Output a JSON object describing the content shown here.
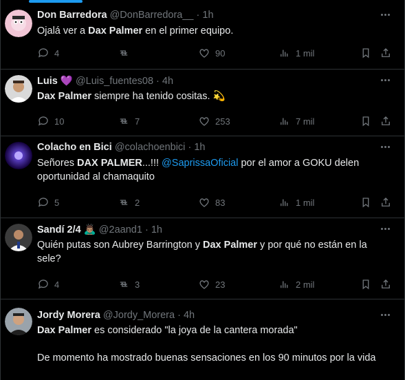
{
  "tweets": [
    {
      "name": "Don Barredora",
      "handle": "@DonBarredora__",
      "time": "1h",
      "body_segments": [
        {
          "text": "Ojalá ver a ",
          "style": "normal"
        },
        {
          "text": "Dax Palmer",
          "style": "bold"
        },
        {
          "text": " en el primer equipo.",
          "style": "normal"
        }
      ],
      "replies": "4",
      "retweets": "",
      "likes": "90",
      "views": "1 mil"
    },
    {
      "name": "Luis",
      "name_badge": "💜",
      "handle": "@Luis_fuentes08",
      "time": "4h",
      "body_segments": [
        {
          "text": "Dax Palmer",
          "style": "bold"
        },
        {
          "text": " siempre ha tenido cositas. 💫",
          "style": "normal"
        }
      ],
      "replies": "10",
      "retweets": "7",
      "likes": "253",
      "views": "7 mil"
    },
    {
      "name": "Colacho en Bici",
      "handle": "@colachoenbici",
      "time": "1h",
      "body_segments": [
        {
          "text": "Señores ",
          "style": "normal"
        },
        {
          "text": "DAX PALMER",
          "style": "bold"
        },
        {
          "text": "...!!! ",
          "style": "normal"
        },
        {
          "text": "@SaprissaOficial",
          "style": "mention"
        },
        {
          "text": " por el amor a GOKU delen oportunidad al chamaquito",
          "style": "normal"
        }
      ],
      "replies": "5",
      "retweets": "2",
      "likes": "83",
      "views": "1 mil"
    },
    {
      "name": "Sandí 2/4",
      "name_badge": "🙇🏽‍♂️",
      "handle": "@2aand1",
      "time": "1h",
      "body_segments": [
        {
          "text": "Quién putas son Aubrey Barrington y ",
          "style": "normal"
        },
        {
          "text": "Dax Palmer",
          "style": "bold"
        },
        {
          "text": " y por qué no están en la sele?",
          "style": "normal"
        }
      ],
      "replies": "4",
      "retweets": "3",
      "likes": "23",
      "views": "2 mil"
    },
    {
      "name": "Jordy Morera",
      "handle": "@Jordy_Morera",
      "time": "4h",
      "body_segments": [
        {
          "text": "Dax Palmer",
          "style": "bold"
        },
        {
          "text": " es considerado \"la joya de la cantera morada\"\n\nDe momento ha mostrado buenas sensaciones en los 90 minutos por la vida",
          "style": "normal"
        }
      ],
      "replies": "",
      "retweets": "",
      "likes": "",
      "views": ""
    }
  ],
  "colors": {
    "background": "#000000",
    "text": "#e7e9ea",
    "muted": "#71767b",
    "accent": "#1d9bf0",
    "border": "#2f3336"
  },
  "icons": [
    "reply-icon",
    "retweet-icon",
    "like-icon",
    "views-icon",
    "bookmark-icon",
    "share-icon",
    "more-icon"
  ]
}
